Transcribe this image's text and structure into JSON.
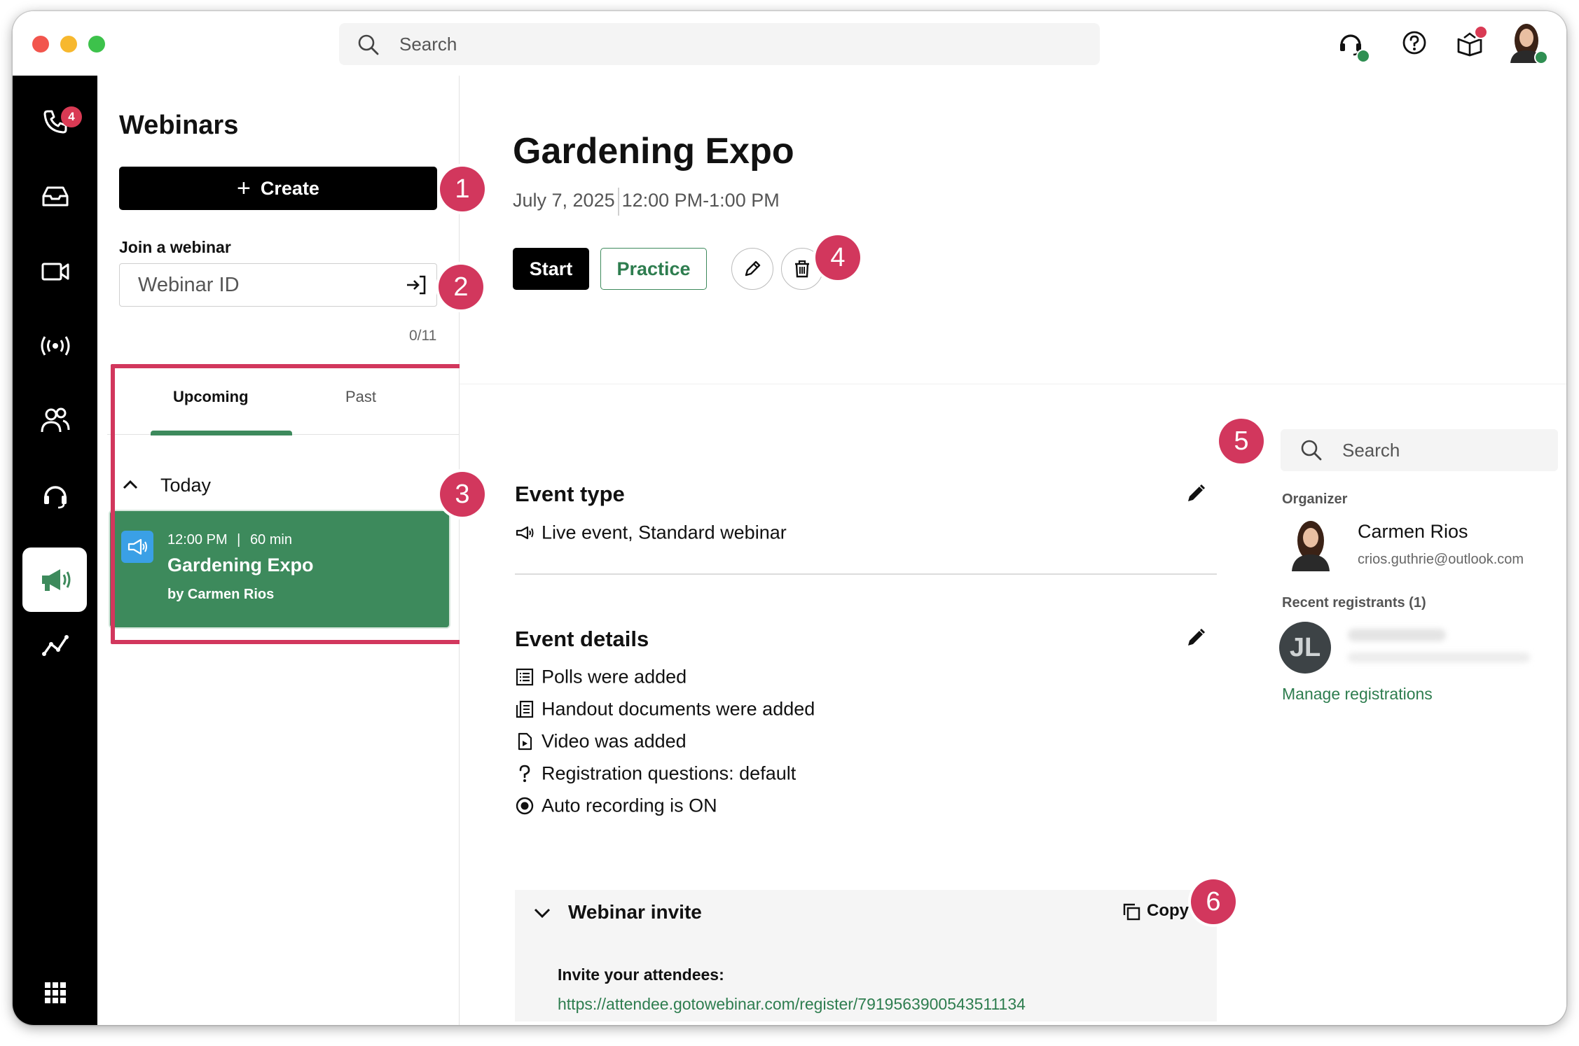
{
  "topbar": {
    "search_placeholder": "Search"
  },
  "rail": {
    "phone_badge": "4"
  },
  "sidebar": {
    "title": "Webinars",
    "create_label": "Create",
    "join_label": "Join a webinar",
    "join_placeholder": "Webinar ID",
    "join_counter": "0/11",
    "tabs": [
      {
        "label": "Upcoming",
        "active": true
      },
      {
        "label": "Past",
        "active": false
      }
    ],
    "group_label": "Today",
    "event_card": {
      "time": "12:00 PM",
      "duration": "60 min",
      "separator": "|",
      "title": "Gardening Expo",
      "by": "by Carmen Rios"
    }
  },
  "event": {
    "title": "Gardening Expo",
    "date": "July 7, 2025",
    "time_range": "12:00 PM-1:00 PM",
    "start_label": "Start",
    "practice_label": "Practice",
    "event_type_title": "Event type",
    "event_type_value": "Live event, Standard webinar",
    "event_details_title": "Event details",
    "details": [
      {
        "icon": "poll-icon",
        "text": "Polls were added"
      },
      {
        "icon": "handout-icon",
        "text": "Handout documents were added"
      },
      {
        "icon": "video-file-icon",
        "text": "Video was added"
      },
      {
        "icon": "question-mark-icon",
        "text": "Registration questions: default"
      },
      {
        "icon": "record-icon",
        "text": "Auto recording is ON"
      }
    ],
    "invite": {
      "title": "Webinar invite",
      "copy_label": "Copy",
      "label": "Invite your attendees:",
      "link": "https://attendee.gotowebinar.com/register/7919563900543511134"
    }
  },
  "right_panel": {
    "search_placeholder": "Search",
    "organizer_label": "Organizer",
    "organizer_name": "Carmen Rios",
    "organizer_email": "crios.guthrie@outlook.com",
    "recent_label": "Recent registrants (1)",
    "registrant_initials": "JL",
    "manage_label": "Manage registrations"
  },
  "callouts": [
    "1",
    "2",
    "3",
    "4",
    "5",
    "6"
  ],
  "colors": {
    "accent_green": "#3d8a5c",
    "callout_pink": "#d2375d",
    "rail_black": "#000000"
  }
}
